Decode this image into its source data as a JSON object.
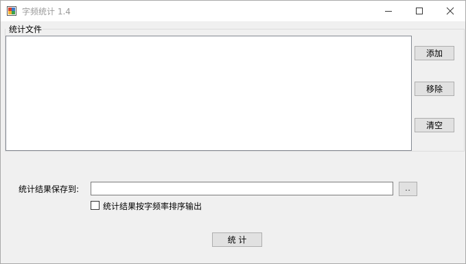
{
  "window": {
    "title": "字频统计 1.4",
    "controls": [
      "minimize-icon",
      "maximize-icon",
      "close-icon"
    ]
  },
  "files_group": {
    "label": "统计文件",
    "items": [],
    "buttons": {
      "add_label": "添加",
      "remove_label": "移除",
      "clear_label": "清空"
    }
  },
  "output": {
    "save_label": "统计结果保存到:",
    "path_value": "",
    "browse_label": "..",
    "sort_checkbox": {
      "label": "统计结果按字频率排序输出",
      "checked": false
    }
  },
  "run_button_label": "统 计"
}
